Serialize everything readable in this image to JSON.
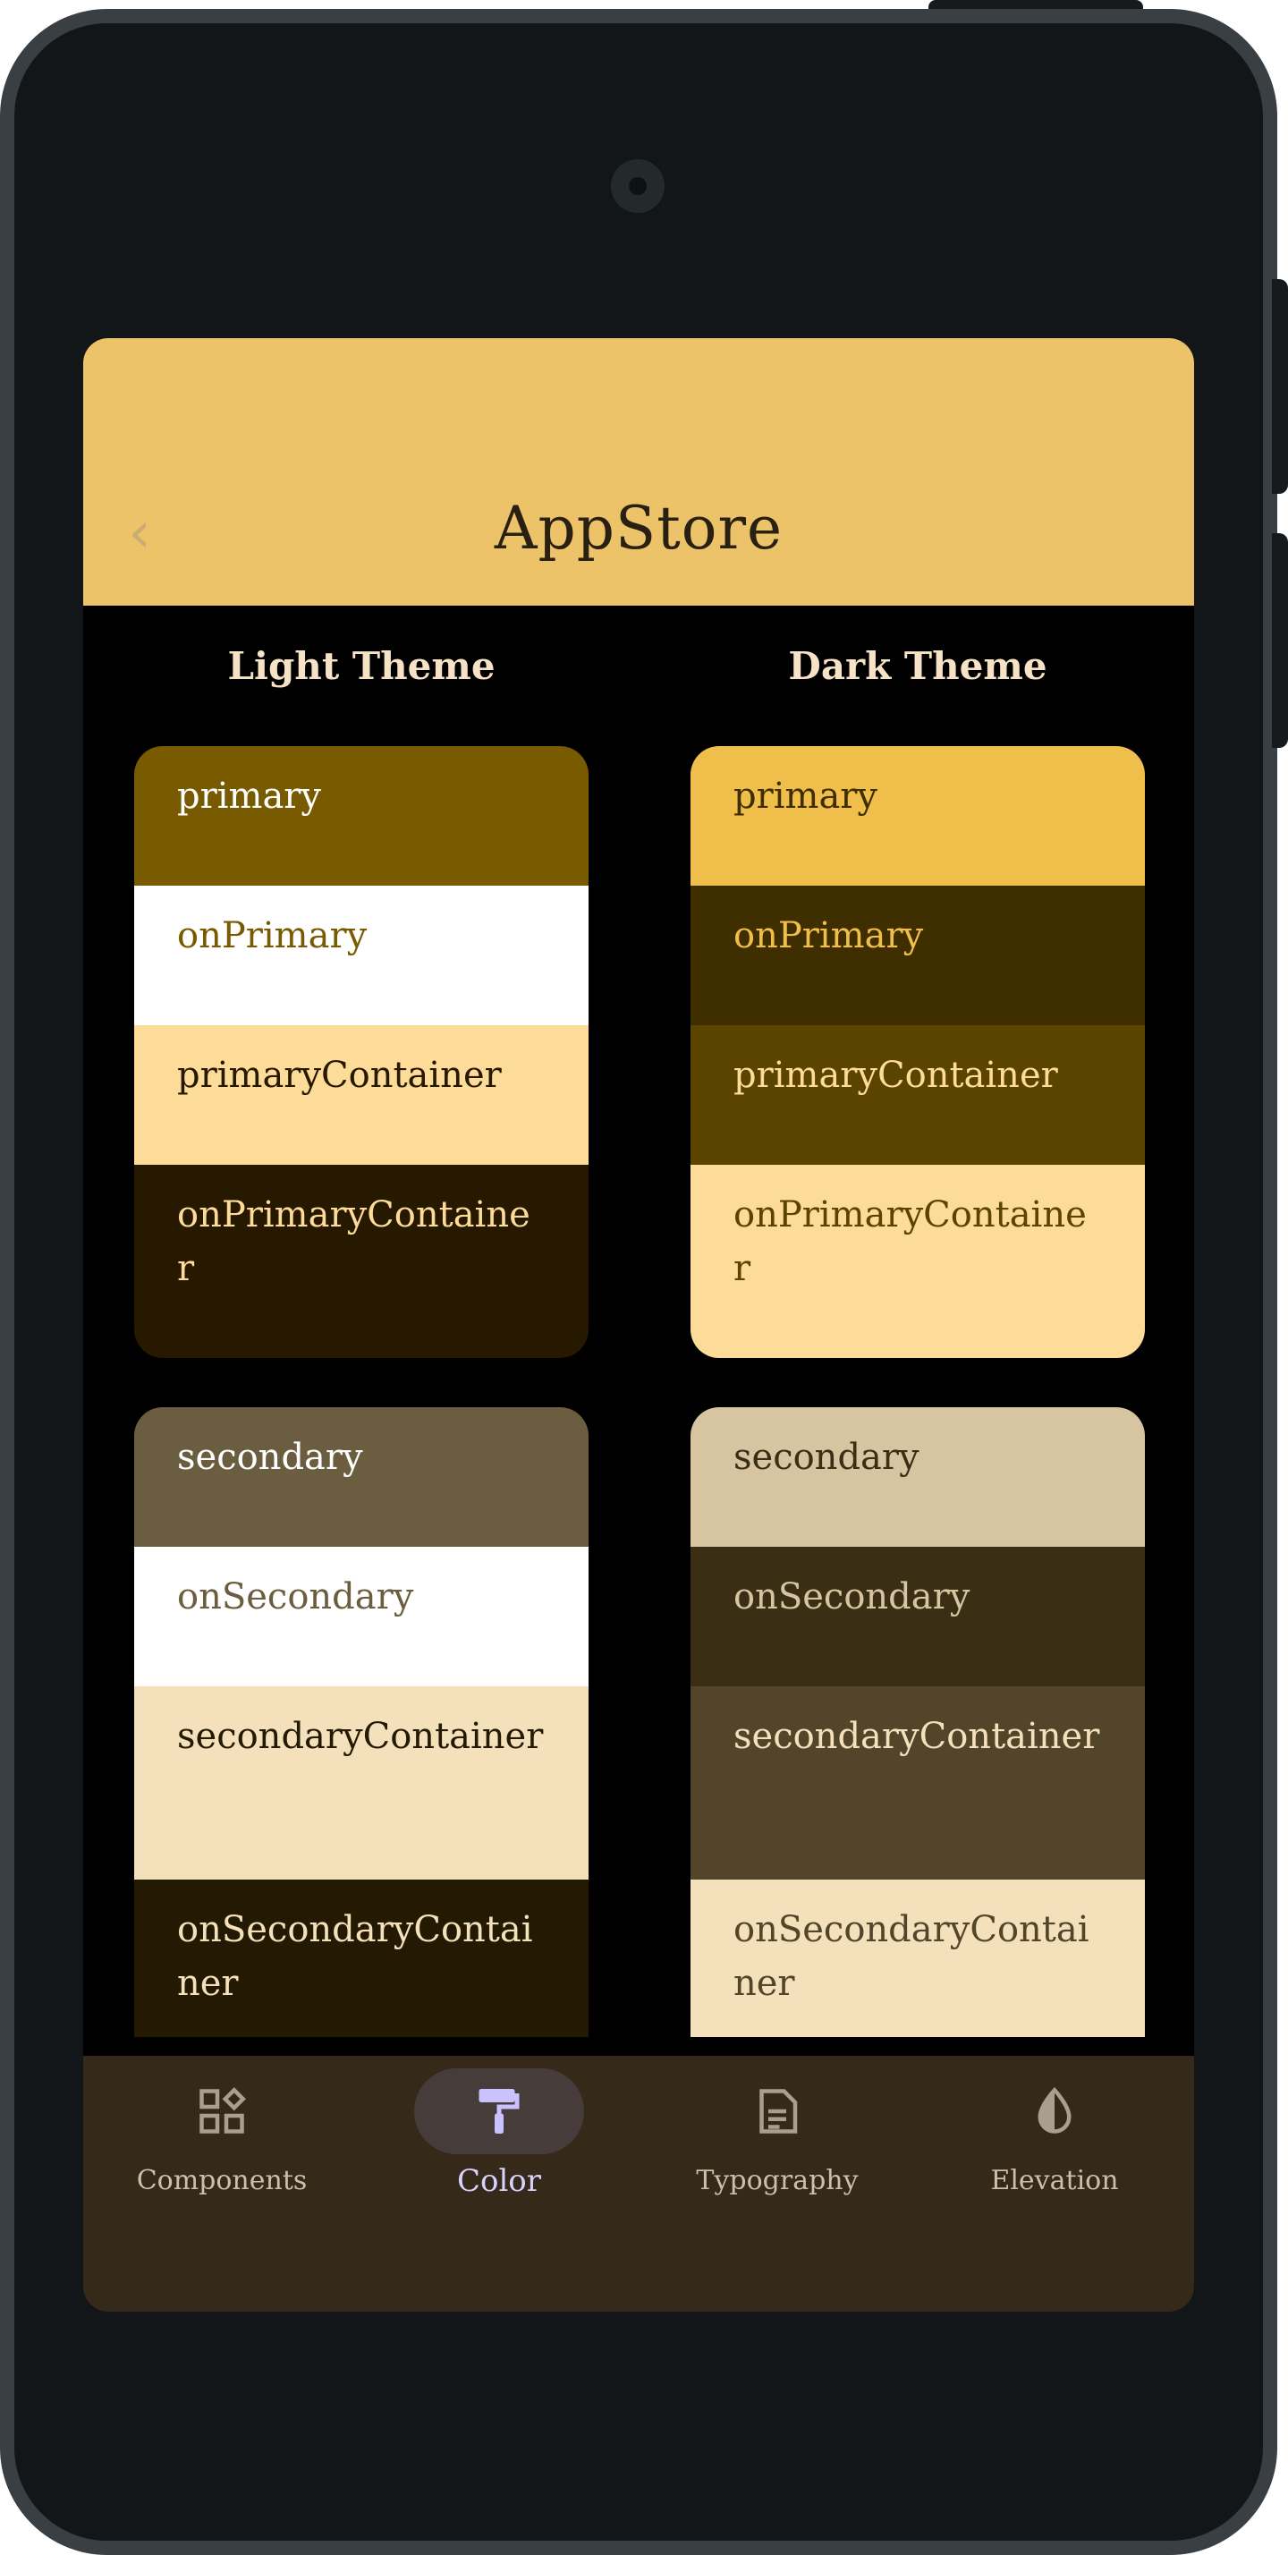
{
  "app": {
    "title": "AppStore",
    "back_glyph": "‹"
  },
  "columns": {
    "light_title": "Light Theme",
    "dark_title": "Dark Theme"
  },
  "light": {
    "primary_group": [
      {
        "label": "primary",
        "bg": "#785a00",
        "fg": "#ffffff"
      },
      {
        "label": "onPrimary",
        "bg": "#ffffff",
        "fg": "#785a00"
      },
      {
        "label": "primaryContainer",
        "bg": "#fddb98",
        "fg": "#261900"
      },
      {
        "label": "onPrimaryContainer",
        "bg": "#261900",
        "fg": "#fddb98"
      }
    ],
    "secondary_group": [
      {
        "label": "secondary",
        "bg": "#6b5d3f",
        "fg": "#ffffff"
      },
      {
        "label": "onSecondary",
        "bg": "#ffffff",
        "fg": "#6b5d3f"
      },
      {
        "label": "secondaryContainer",
        "bg": "#f4e0bb",
        "fg": "#241a04"
      },
      {
        "label": "onSecondaryContainer",
        "bg": "#241a04",
        "fg": "#f4e0bb"
      }
    ]
  },
  "dark": {
    "primary_group": [
      {
        "label": "primary",
        "bg": "#f0be4a",
        "fg": "#3f2e00"
      },
      {
        "label": "onPrimary",
        "bg": "#3f2e00",
        "fg": "#f0be4a"
      },
      {
        "label": "primaryContainer",
        "bg": "#5b4300",
        "fg": "#fddb98"
      },
      {
        "label": "onPrimaryContainer",
        "bg": "#fddb98",
        "fg": "#5b4300"
      }
    ],
    "secondary_group": [
      {
        "label": "secondary",
        "bg": "#d7c4a0",
        "fg": "#3a2f15"
      },
      {
        "label": "onSecondary",
        "bg": "#3a2f15",
        "fg": "#d7c4a0"
      },
      {
        "label": "secondaryContainer",
        "bg": "#52452a",
        "fg": "#f4e0bb"
      },
      {
        "label": "onSecondaryContainer",
        "bg": "#f4e0bb",
        "fg": "#52452a"
      }
    ]
  },
  "nav": [
    {
      "label": "Components",
      "icon": "components-icon",
      "active": false
    },
    {
      "label": "Color",
      "icon": "paint-roller-icon",
      "active": true
    },
    {
      "label": "Typography",
      "icon": "document-icon",
      "active": false
    },
    {
      "label": "Elevation",
      "icon": "contrast-drop-icon",
      "active": false
    }
  ],
  "colors": {
    "appbar": "#ecc369",
    "nav_bg": "#352a1a",
    "active_pill": "#463d3a",
    "active_label": "#d8d2ff"
  }
}
